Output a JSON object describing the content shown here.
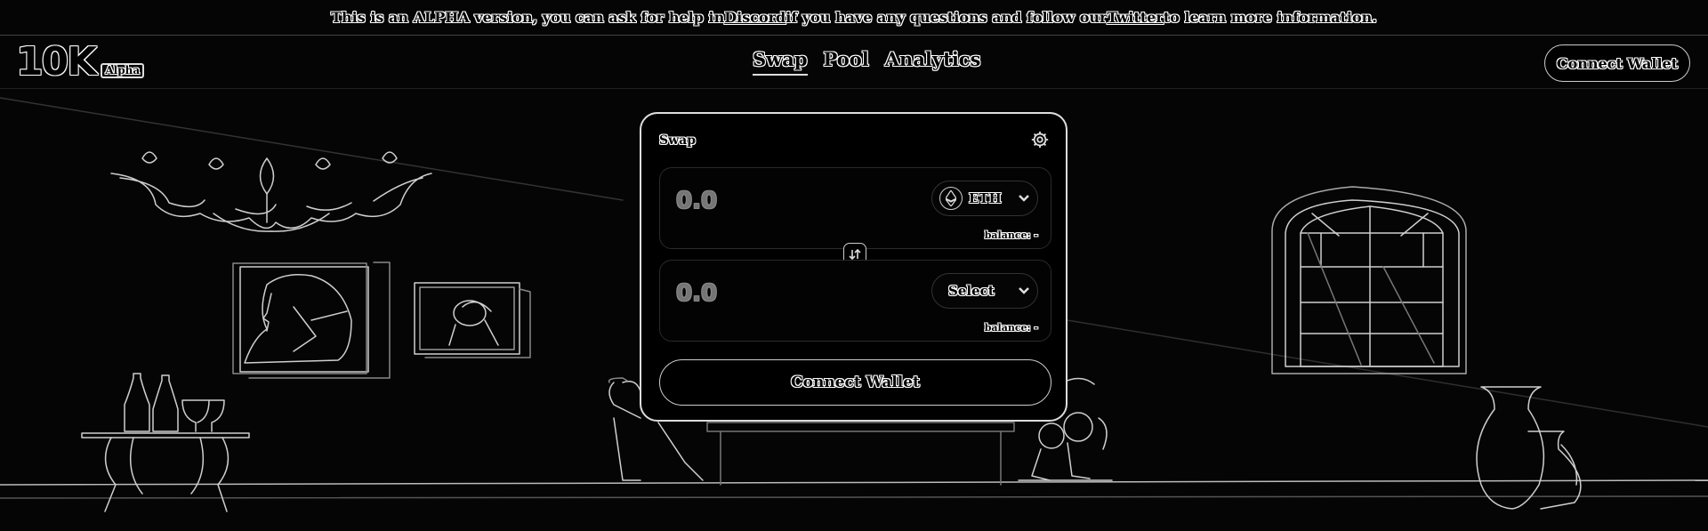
{
  "banner": {
    "text_before": "This is an ALPHA version, you can ask for help in ",
    "discord_link": "Discord",
    "text_middle": " if you have any questions and follow our ",
    "twitter_link": "Twitter",
    "text_after": " to learn more information."
  },
  "header": {
    "logo_text": "10K",
    "logo_badge": "Alpha",
    "nav": [
      "Swap",
      "Pool",
      "Analytics"
    ],
    "connect_label": "Connect Wallet"
  },
  "swap": {
    "title": "Swap",
    "from": {
      "amount_placeholder": "0.0",
      "token": "ETH",
      "balance": "balance: -"
    },
    "to": {
      "amount_placeholder": "0.0",
      "token": "Select",
      "balance": "balance: -"
    },
    "connect_label": "Connect Wallet"
  },
  "colors": {
    "background": "#050505",
    "line": "#d8d8d8",
    "card_border": "#dddddd"
  }
}
